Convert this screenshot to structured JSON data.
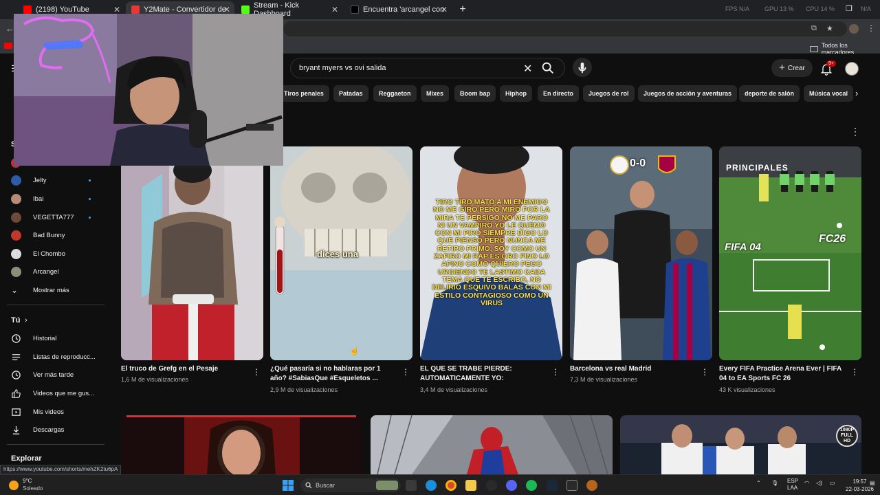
{
  "browser": {
    "tabs": [
      {
        "title": "(2198) YouTube",
        "color": "#ff0000",
        "active": false
      },
      {
        "title": "Y2Mate - Convertidor de YouTu",
        "color": "#e53935",
        "active": true
      },
      {
        "title": "Stream - Kick Dashboard",
        "color": "#53fc18",
        "active": false
      },
      {
        "title": "Encuentra 'arcangel corrige a A",
        "color": "#111111",
        "active": false
      }
    ],
    "perf": {
      "fps": "FPS N/A",
      "gpu": "GPU 13 %",
      "cpu": "CPU 14 %",
      "extra": "N/A"
    },
    "bookmarks_all": "Todos los marcadores",
    "status_url": "https://www.youtube.com/shorts/mehZK2tu6pA"
  },
  "header": {
    "search_query": "bryant myers vs ovi salida",
    "create_label": "Crear",
    "notif_badge": "9+"
  },
  "chips": [
    "Tiros penales",
    "Patadas",
    "Reggaeton",
    "Mixes",
    "Boom bap",
    "Hiphop",
    "En directo",
    "Juegos de rol",
    "Juegos de acción y aventuras",
    "deporte de salón",
    "Música vocal"
  ],
  "sidebar": {
    "subscriptions_initial": "S",
    "channels": [
      {
        "name": "Jelty",
        "color": "#2f5aa8",
        "new": true
      },
      {
        "name": "Ibai",
        "color": "#b88b77",
        "new": true
      },
      {
        "name": "VEGETTA777",
        "color": "#6b4a3a",
        "new": true
      },
      {
        "name": "Bad Bunny",
        "color": "#c0392b",
        "new": false
      },
      {
        "name": "El Chombo",
        "color": "#dcdcdc",
        "new": false
      },
      {
        "name": "Arcangel",
        "color": "#8a8f7a",
        "new": false
      }
    ],
    "show_more": "Mostrar más",
    "you_heading": "Tú",
    "you_items": [
      {
        "label": "Historial",
        "icon": "history-icon"
      },
      {
        "label": "Listas de reproducc...",
        "icon": "playlist-icon"
      },
      {
        "label": "Ver más tarde",
        "icon": "watch-later-icon"
      },
      {
        "label": "Videos que me gus...",
        "icon": "like-icon"
      },
      {
        "label": "Mis videos",
        "icon": "my-videos-icon"
      },
      {
        "label": "Descargas",
        "icon": "download-icon"
      }
    ],
    "explore_heading": "Explorar"
  },
  "shorts": [
    {
      "title": "El truco de Grefg en el Pesaje",
      "views": "1,6 M de visualizaciones",
      "overlay": ""
    },
    {
      "title": "¿Qué pasaría si no hablaras por 1 año? #SabiasQue #Esqueletos ...",
      "views": "2,9 M de visualizaciones",
      "overlay": "dices una"
    },
    {
      "title": "EL QUE SE TRABE PIERDE: AUTOMATICAMENTE YO:",
      "views": "3,4 M de visualizaciones",
      "overlay": "TIRO TIRO MATO A MI ENEMIGO NO ME GIRO PERO MIRO POR LA MIRA TE PERSIGO NO ME PARO NI UN VAMPIRO YO LE QUEMO CON MI PIRO SIEMPRE DIGO LO QUE PIENSO PERO NUNCA ME RETIRO PRIMO, SOY COMO UN ZAFIRO MI RAP ES ORO FINO LO AFINO COMO QUIERO PEGO URGIENDO TE LASTIMO CADA TEMA QUE TE ESCRIBO, NO DELIRIO ESQUIVO BALAS CON MI ESTILO CONTAGIOSO COMO UN VIRUS"
    },
    {
      "title": "Barcelona vs real Madrid",
      "views": "7,3 M de visualizaciones",
      "overlay": "0-0"
    },
    {
      "title": "Every FIFA Practice Arena Ever | FIFA 04 to EA Sports FC 26",
      "views": "43 K visualizaciones",
      "overlay": "FIFA 04",
      "overlay2": "FC26",
      "overlay3": "PRINCIPALES"
    }
  ],
  "row2_badge": "1080P FULL HD",
  "taskbar": {
    "temp": "9°C",
    "weather": "Soleado",
    "search_placeholder": "Buscar",
    "lang": "ESP",
    "lang2": "LAA",
    "time": "19:57",
    "date": "22-03-2026"
  }
}
